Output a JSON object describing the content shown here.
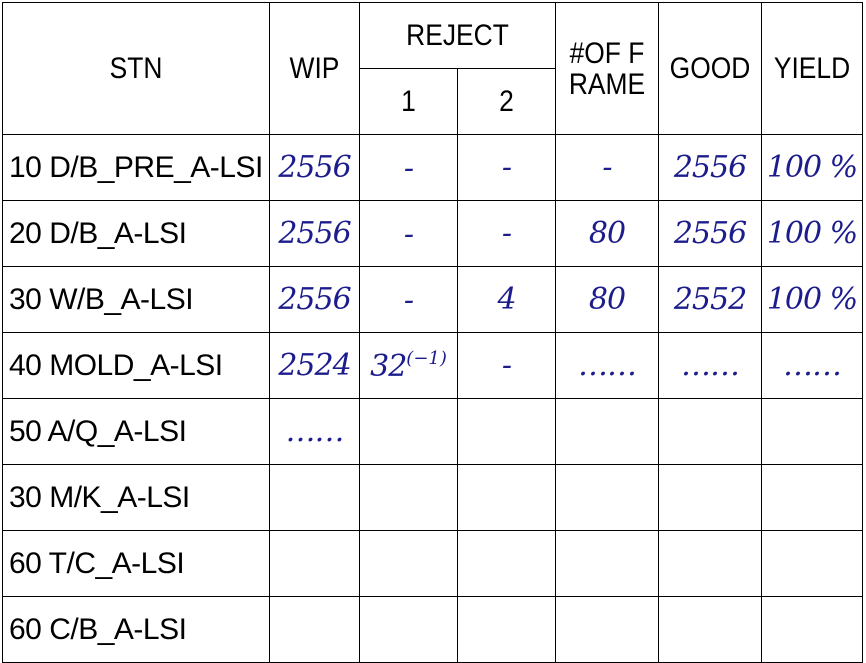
{
  "headers": {
    "stn": "STN",
    "wip": "WIP",
    "reject": "REJECT",
    "reject_1": "1",
    "reject_2": "2",
    "frames": "#OF FRAME",
    "good": "GOOD",
    "yield": "YIELD"
  },
  "rows": [
    {
      "stn": "10 D/B_PRE_A-LSI",
      "wip": "2556",
      "rej1": "-",
      "rej1_sup": "",
      "rej2": "-",
      "frames": "-",
      "good": "2556",
      "yield": "100 %"
    },
    {
      "stn": "20 D/B_A-LSI",
      "wip": "2556",
      "rej1": "-",
      "rej1_sup": "",
      "rej2": "-",
      "frames": "80",
      "good": "2556",
      "yield": "100 %"
    },
    {
      "stn": "30 W/B_A-LSI",
      "wip": "2556",
      "rej1": "-",
      "rej1_sup": "",
      "rej2": "4",
      "frames": "80",
      "good": "2552",
      "yield": "100 %"
    },
    {
      "stn": "40 MOLD_A-LSI",
      "wip": "2524",
      "rej1": "32",
      "rej1_sup": "(−1)",
      "rej2": "-",
      "frames": "……",
      "good": "……",
      "yield": "……"
    },
    {
      "stn": "50 A/Q_A-LSI",
      "wip": "……",
      "rej1": "",
      "rej1_sup": "",
      "rej2": "",
      "frames": "",
      "good": "",
      "yield": ""
    },
    {
      "stn": "30 M/K_A-LSI",
      "wip": "",
      "rej1": "",
      "rej1_sup": "",
      "rej2": "",
      "frames": "",
      "good": "",
      "yield": ""
    },
    {
      "stn": "60 T/C_A-LSI",
      "wip": "",
      "rej1": "",
      "rej1_sup": "",
      "rej2": "",
      "frames": "",
      "good": "",
      "yield": ""
    },
    {
      "stn": "60 C/B_A-LSI",
      "wip": "",
      "rej1": "",
      "rej1_sup": "",
      "rej2": "",
      "frames": "",
      "good": "",
      "yield": ""
    }
  ]
}
